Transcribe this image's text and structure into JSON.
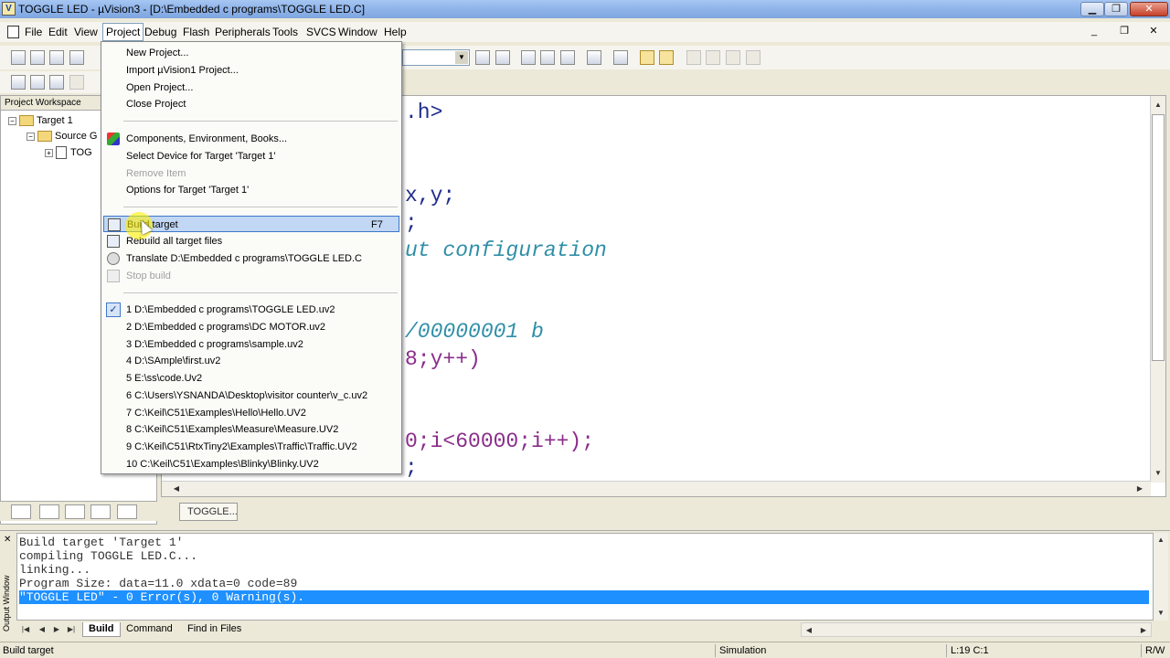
{
  "window": {
    "title": "TOGGLE LED  - µVision3 - [D:\\Embedded c programs\\TOGGLE LED.C]",
    "app_icon": "µVision-logo-icon",
    "minimize": "▁",
    "maximize": "❐",
    "close": "✕"
  },
  "menubar": {
    "items": [
      "File",
      "Edit",
      "View",
      "Project",
      "Debug",
      "Flash",
      "Peripherals",
      "Tools",
      "SVCS",
      "Window",
      "Help"
    ],
    "active": "Project",
    "mdi_minimize": "_",
    "mdi_restore": "❐",
    "mdi_close": "✕"
  },
  "workspace": {
    "header": "Project Workspace",
    "tree": [
      {
        "label": "Target 1",
        "expander": "−"
      },
      {
        "label": "Source G",
        "expander": "−"
      },
      {
        "label": "TOG",
        "expander": "+"
      }
    ]
  },
  "editor": {
    "lines": [
      {
        "text": ".h>",
        "style": "c-default"
      },
      {
        "text": "x,y;",
        "style": "c-default"
      },
      {
        "text": ";",
        "style": "c-default"
      },
      {
        "text": "ut configuration",
        "style": "c-italic"
      },
      {
        "text": "/00000001 b",
        "style": "c-italic"
      },
      {
        "text": "8;y++)",
        "style": "c-purple"
      },
      {
        "text": "0;i<60000;i++);",
        "style": "c-purple"
      },
      {
        "text": ";",
        "style": "c-default"
      }
    ],
    "tab_label": "TOGGLE..."
  },
  "dropdown": {
    "groups": [
      [
        {
          "label": "New Project...",
          "enabled": true
        },
        {
          "label": "Import µVision1 Project...",
          "enabled": true
        },
        {
          "label": "Open Project...",
          "enabled": true
        },
        {
          "label": "Close Project",
          "enabled": true
        }
      ],
      [
        {
          "label": "Components, Environment, Books...",
          "enabled": true,
          "icon": "components-icon"
        },
        {
          "label": "Select Device for Target 'Target 1'",
          "enabled": true
        },
        {
          "label": "Remove Item",
          "enabled": false
        },
        {
          "label": "Options for Target 'Target 1'",
          "enabled": true
        }
      ],
      [
        {
          "label": "Build target",
          "shortcut": "F7",
          "enabled": true,
          "icon": "build-icon",
          "highlight": true
        },
        {
          "label": "Rebuild all target files",
          "enabled": true,
          "icon": "rebuild-icon"
        },
        {
          "label": "Translate D:\\Embedded c programs\\TOGGLE LED.C",
          "enabled": true,
          "icon": "translate-icon"
        },
        {
          "label": "Stop build",
          "enabled": false,
          "icon": "stop-build-icon"
        }
      ],
      [
        {
          "label": "1 D:\\Embedded c programs\\TOGGLE LED.uv2",
          "enabled": true,
          "checked": true
        },
        {
          "label": "2 D:\\Embedded c programs\\DC MOTOR.uv2",
          "enabled": true
        },
        {
          "label": "3 D:\\Embedded c programs\\sample.uv2",
          "enabled": true
        },
        {
          "label": "4 D:\\SAmple\\first.uv2",
          "enabled": true
        },
        {
          "label": "5 E:\\ss\\code.Uv2",
          "enabled": true
        },
        {
          "label": "6 C:\\Users\\YSNANDA\\Desktop\\visitor counter\\v_c.uv2",
          "enabled": true
        },
        {
          "label": "7 C:\\Keil\\C51\\Examples\\Hello\\Hello.UV2",
          "enabled": true
        },
        {
          "label": "8 C:\\Keil\\C51\\Examples\\Measure\\Measure.UV2",
          "enabled": true
        },
        {
          "label": "9 C:\\Keil\\C51\\RtxTiny2\\Examples\\Traffic\\Traffic.UV2",
          "enabled": true
        },
        {
          "label": "10 C:\\Keil\\C51\\Examples\\Blinky\\Blinky.UV2",
          "enabled": true
        }
      ]
    ]
  },
  "output": {
    "side_label": "Output Window",
    "lines": [
      "Build target 'Target 1'",
      "compiling TOGGLE LED.C...",
      "linking...",
      "Program Size: data=11.0 xdata=0 code=89",
      "\"TOGGLE LED\" - 0 Error(s), 0 Warning(s)."
    ],
    "selected_line_index": 4,
    "tabs": [
      "Build",
      "Command",
      "Find in Files"
    ],
    "active_tab": "Build"
  },
  "statusbar": {
    "message": "Build target",
    "mode": "Simulation",
    "position": "L:19 C:1",
    "access": "R/W"
  },
  "colors": {
    "code_default": "#1f2d8a",
    "code_comment": "#2f8fa8",
    "code_purple": "#8a2d8a",
    "selection": "#1e90ff",
    "menu_highlight": "#c1d7f4"
  }
}
